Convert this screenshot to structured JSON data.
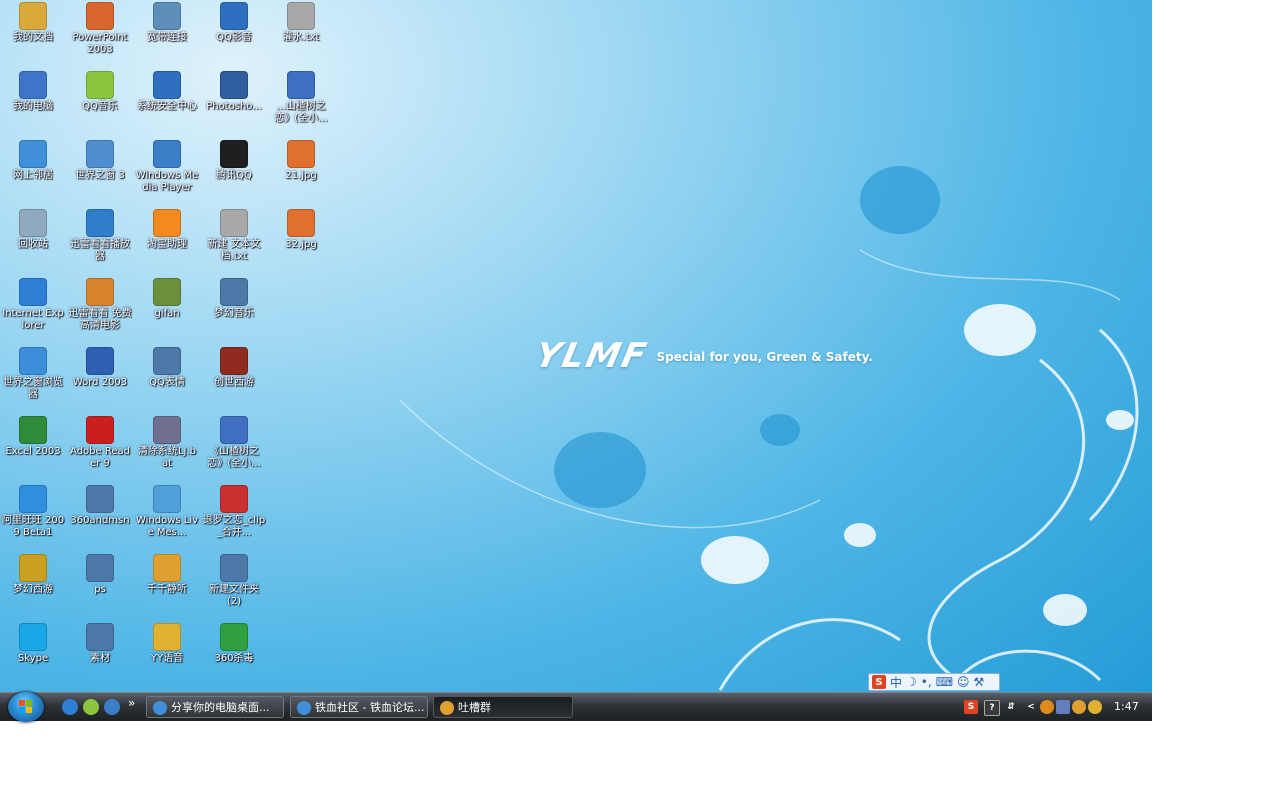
{
  "wallpaper": {
    "brand_logo": "YLMF",
    "brand_tagline": "Special for you, Green & Safety."
  },
  "desktop_icons": [
    {
      "label": "我的文档",
      "icon": "folder-documents-icon",
      "color": "#d9a93a"
    },
    {
      "label": "我的电脑",
      "icon": "computer-icon",
      "color": "#3f74c9"
    },
    {
      "label": "网上邻居",
      "icon": "network-icon",
      "color": "#3f8fd9"
    },
    {
      "label": "回收站",
      "icon": "recycle-bin-icon",
      "color": "#8fa9bf"
    },
    {
      "label": "Internet Explorer",
      "icon": "internet-explorer-icon",
      "color": "#2f7fd6"
    },
    {
      "label": "世界之窗浏览器",
      "icon": "theworld-browser-icon",
      "color": "#3c8edb"
    },
    {
      "label": "Excel 2003",
      "icon": "excel-icon",
      "color": "#2e8b3a"
    },
    {
      "label": "阿里旺旺 2009 Beta1",
      "icon": "aliwangwang-icon",
      "color": "#2f8fe0"
    },
    {
      "label": "梦幻西游",
      "icon": "menghuan-game-icon",
      "color": "#c9a020"
    },
    {
      "label": "Skype",
      "icon": "skype-icon",
      "color": "#18a8e8"
    },
    {
      "label": "PowerPoint 2003",
      "icon": "powerpoint-icon",
      "color": "#d9662c"
    },
    {
      "label": "QQ音乐",
      "icon": "qq-music-icon",
      "color": "#8cc63f"
    },
    {
      "label": "世界之窗 3",
      "icon": "theworld-3-icon",
      "color": "#4f8fd0"
    },
    {
      "label": "迅雷看看播放器",
      "icon": "xunlei-player-icon",
      "color": "#2f7ec9"
    },
    {
      "label": "迅雷看看 免费高清电影",
      "icon": "xunlei-movie-icon",
      "color": "#d9832c"
    },
    {
      "label": "Word 2003",
      "icon": "word-icon",
      "color": "#2f5fb3"
    },
    {
      "label": "Adobe Reader 9",
      "icon": "adobe-reader-icon",
      "color": "#c9201f"
    },
    {
      "label": "360andmsn",
      "icon": "folder-shortcut-icon",
      "color": "#4d78a8"
    },
    {
      "label": "ps",
      "icon": "folder-shortcut-icon",
      "color": "#4d78a8"
    },
    {
      "label": "素材",
      "icon": "folder-shortcut-icon",
      "color": "#4d78a8"
    },
    {
      "label": "宽带连接",
      "icon": "broadband-connection-icon",
      "color": "#5e8fb8"
    },
    {
      "label": "系统安全中心",
      "icon": "security-center-icon",
      "color": "#2f6fc0"
    },
    {
      "label": "Windows Media Player",
      "icon": "media-player-icon",
      "color": "#3a7fc8"
    },
    {
      "label": "淘宝助理",
      "icon": "taobao-assistant-icon",
      "color": "#f28a1e"
    },
    {
      "label": "gifan",
      "icon": "film-icon",
      "color": "#6b8f3a"
    },
    {
      "label": "QQ表情",
      "icon": "folder-shortcut-icon",
      "color": "#4d78a8"
    },
    {
      "label": "清除系统LJ.bat",
      "icon": "batch-file-icon",
      "color": "#6f6f8f"
    },
    {
      "label": "Windows Live Mes...",
      "icon": "live-messenger-icon",
      "color": "#4f9fd8"
    },
    {
      "label": "千千静听",
      "icon": "ttplayer-icon",
      "color": "#e0a030"
    },
    {
      "label": "YY语音",
      "icon": "yy-voice-icon",
      "color": "#e0b030"
    },
    {
      "label": "QQ影音",
      "icon": "qq-player-icon",
      "color": "#2f6fc0"
    },
    {
      "label": "Photosho...",
      "icon": "photoshop-icon",
      "color": "#2f5f9f"
    },
    {
      "label": "腾讯QQ",
      "icon": "qq-penguin-icon",
      "color": "#1f1f1f"
    },
    {
      "label": "新建 文本文档.txt",
      "icon": "text-file-icon",
      "color": "#a8a8a8"
    },
    {
      "label": "梦幻音乐",
      "icon": "folder-shortcut-icon",
      "color": "#4d78a8"
    },
    {
      "label": "创世西游",
      "icon": "chuangshi-game-icon",
      "color": "#8f2a1f"
    },
    {
      "label": "《山楂树之恋》(全小...",
      "icon": "word-doc-icon",
      "color": "#3f6fc0"
    },
    {
      "label": "退罗之恋_clip_合并...",
      "icon": "rmvb-video-icon",
      "color": "#c9302f"
    },
    {
      "label": "新建文件夹 (2)",
      "icon": "folder-shortcut-icon",
      "color": "#4d78a8"
    },
    {
      "label": "360杀毒",
      "icon": "antivirus-360-icon",
      "color": "#2f9f3f"
    },
    {
      "label": "灌水.txt",
      "icon": "text-file-icon",
      "color": "#a8a8a8"
    },
    {
      "label": "...山楂树之恋》(全小...",
      "icon": "word-doc-icon",
      "color": "#3f6fc0"
    },
    {
      "label": "21.jpg",
      "icon": "jpg-image-icon",
      "color": "#e07030"
    },
    {
      "label": "32.jpg",
      "icon": "jpg-image-icon",
      "color": "#e07030"
    }
  ],
  "taskbar": {
    "start_icon": "windows-start-icon",
    "quick_launch": [
      {
        "icon": "internet-explorer-icon",
        "color": "#2f7fd6"
      },
      {
        "icon": "show-desktop-icon",
        "color": "#8cc63f"
      },
      {
        "icon": "media-player-icon",
        "color": "#3a7fc8"
      }
    ],
    "overflow_chevron": "»",
    "tasks": [
      {
        "label": "分享你的电脑桌面...",
        "icon": "browser-window-icon",
        "color": "#3f8fd9",
        "active": false
      },
      {
        "label": "铁血社区 - 铁血论坛...",
        "icon": "browser-window-icon",
        "color": "#3f8fd9",
        "active": false
      },
      {
        "label": "吐槽群",
        "icon": "qq-group-icon",
        "color": "#e0a030",
        "active": true
      }
    ],
    "tray": {
      "clock": "1:47",
      "expand_arrow": "<"
    }
  },
  "ime_bar": {
    "mode": "中",
    "icons": [
      "sogou-ime-icon",
      "half-moon-icon",
      "punctuation-icon",
      "keyboard-icon",
      "user-icon",
      "wrench-icon"
    ]
  }
}
